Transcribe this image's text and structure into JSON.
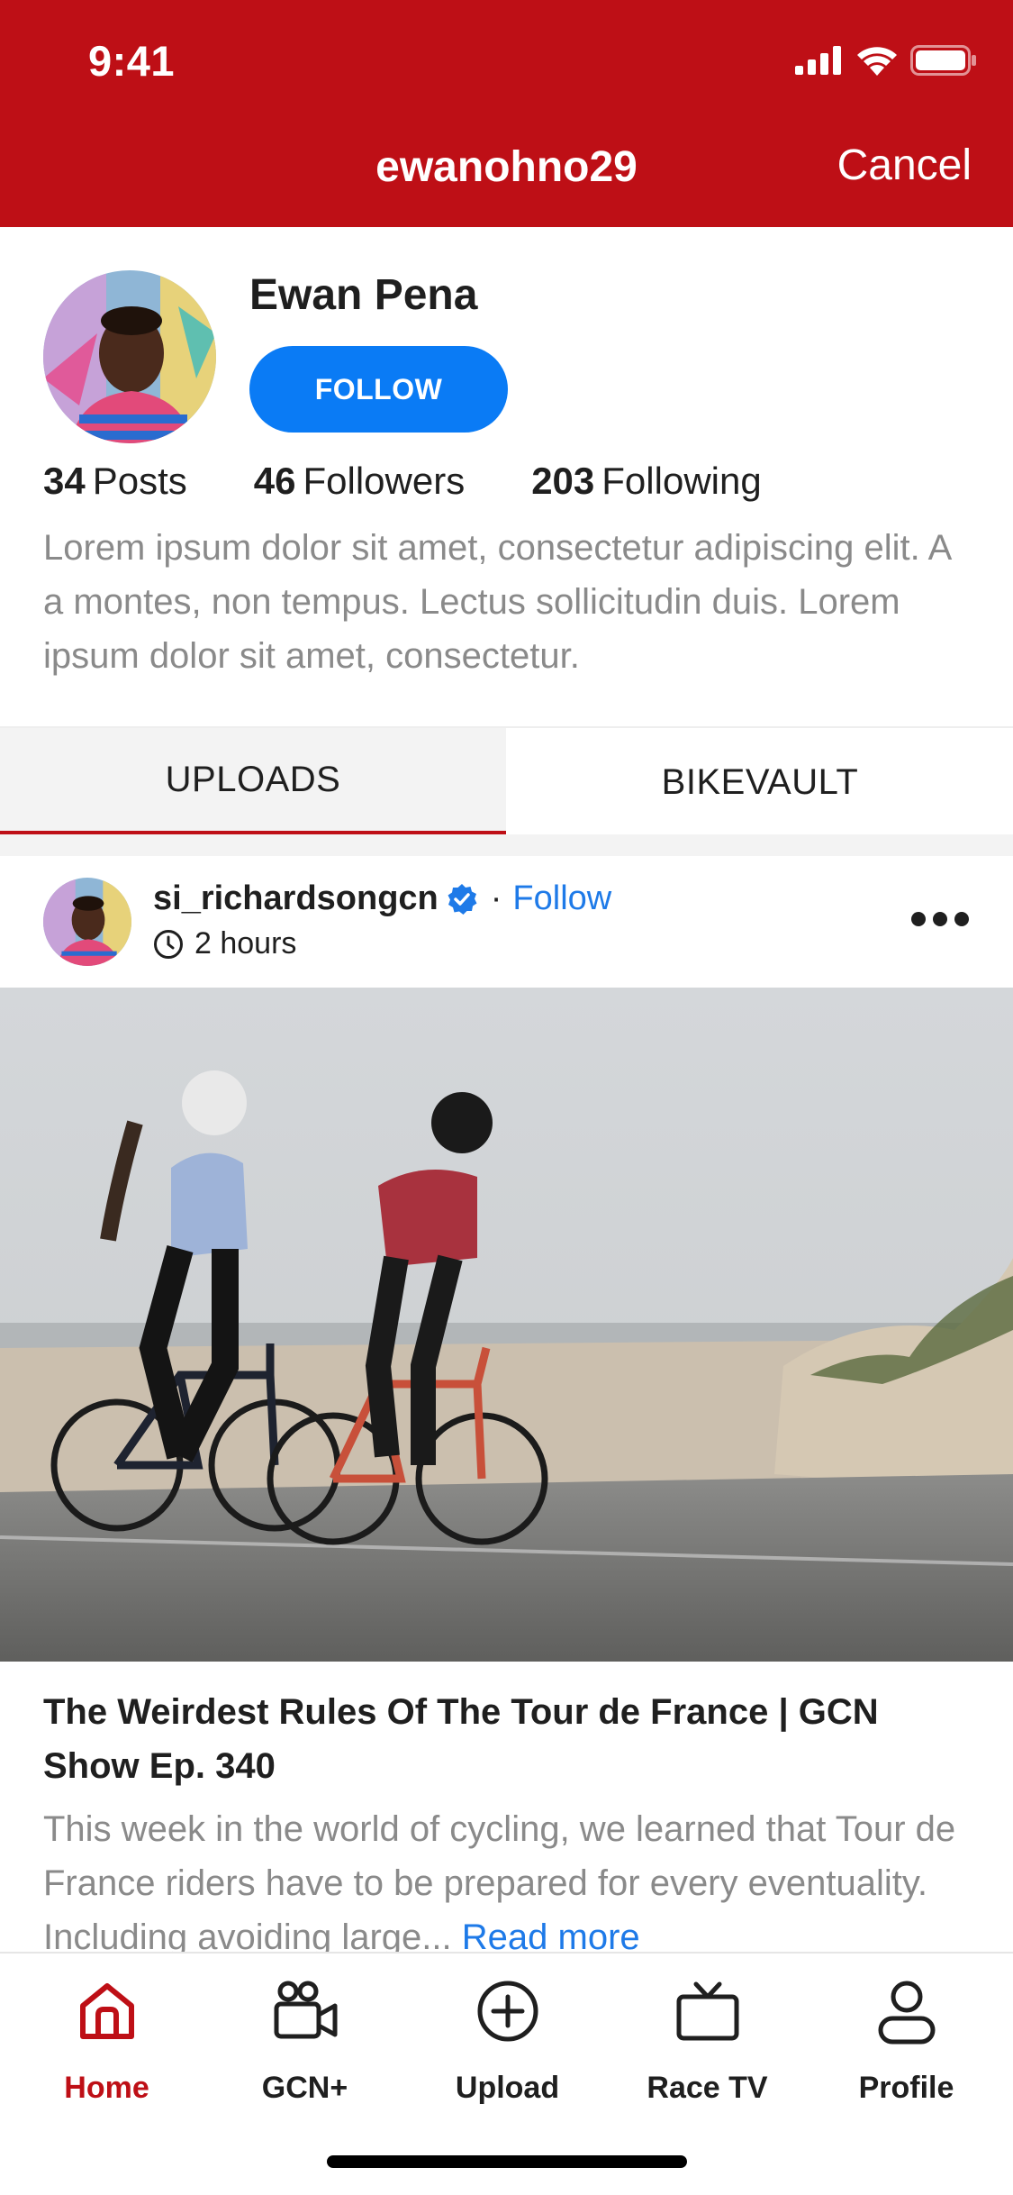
{
  "status": {
    "time": "9:41"
  },
  "nav": {
    "title": "ewanohno29",
    "cancel_label": "Cancel"
  },
  "profile": {
    "name": "Ewan Pena",
    "follow_label": "FOLLOW",
    "stats": [
      {
        "count": "34",
        "label": "Posts"
      },
      {
        "count": "46",
        "label": "Followers"
      },
      {
        "count": "203",
        "label": "Following"
      }
    ],
    "bio": "Lorem ipsum dolor sit amet, consectetur adipiscing elit. A a montes, non tempus. Lectus sollicitudin duis. Lorem ipsum dolor sit amet, consectetur."
  },
  "tabs": {
    "uploads": "UPLOADS",
    "bikevault": "BIKEVAULT"
  },
  "post": {
    "username": "si_richardsongcn",
    "separator": "·",
    "follow_label": "Follow",
    "time": "2 hours",
    "title": "The Weirdest Rules Of The Tour de France | GCN Show Ep. 340",
    "description": "This week in the world of cycling, we learned that Tour de France riders have to be prepared for every eventuality. Including avoiding large...",
    "read_more": "Read more"
  },
  "tabbar": {
    "items": [
      {
        "label": "Home",
        "icon": "home-icon",
        "active": true
      },
      {
        "label": "GCN+",
        "icon": "video-camera-icon",
        "active": false
      },
      {
        "label": "Upload",
        "icon": "plus-circle-icon",
        "active": false
      },
      {
        "label": "Race TV",
        "icon": "tv-icon",
        "active": false
      },
      {
        "label": "Profile",
        "icon": "person-icon",
        "active": false
      }
    ]
  },
  "colors": {
    "brand_red": "#be0f16",
    "follow_blue": "#0a7bf5",
    "link_blue": "#1e7ae8",
    "muted_text": "#8a8a8a"
  }
}
